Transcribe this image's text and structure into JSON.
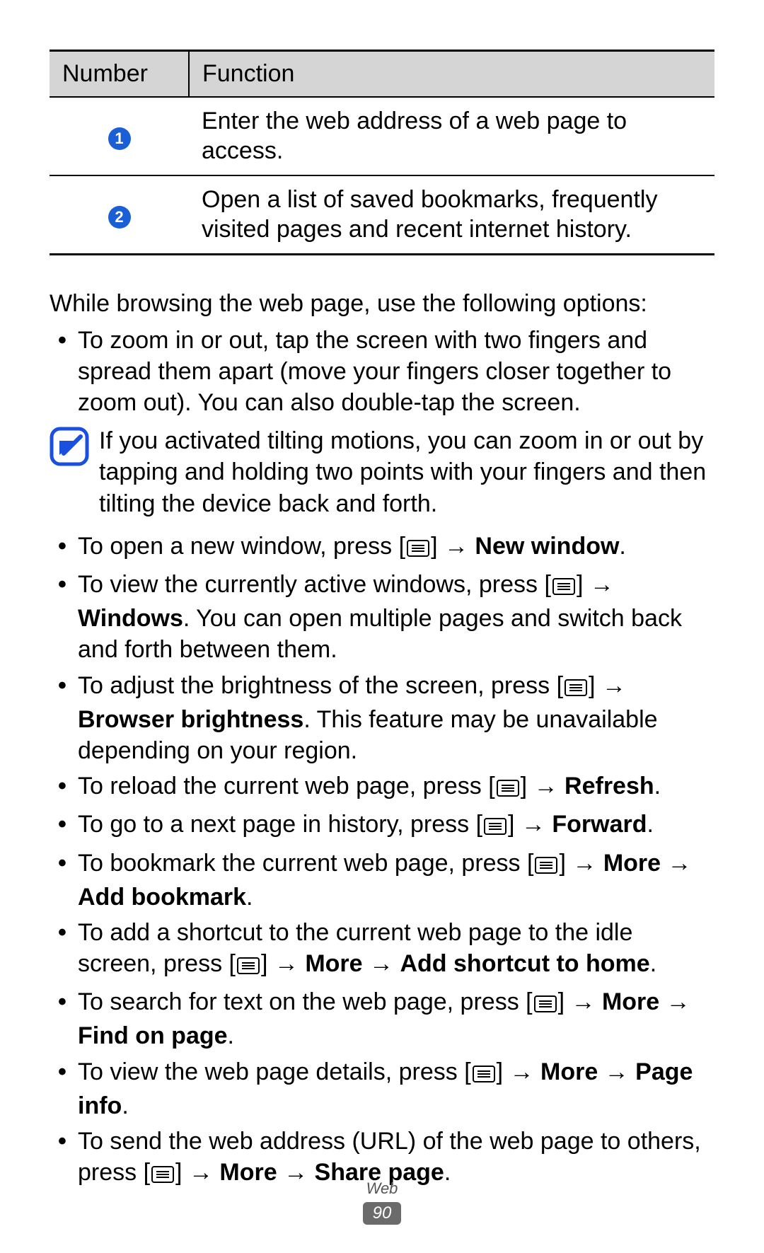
{
  "table": {
    "headers": {
      "number": "Number",
      "function": "Function"
    },
    "rows": [
      {
        "num": "1",
        "func": "Enter the web address of a web page to access."
      },
      {
        "num": "2",
        "func": "Open a list of saved bookmarks, frequently visited pages and recent internet history."
      }
    ]
  },
  "intro": "While browsing the web page, use the following options:",
  "bullets": {
    "zoom": "To zoom in or out, tap the screen with two fingers and spread them apart (move your fingers closer together to zoom out). You can also double-tap the screen.",
    "note": "If you activated tilting motions, you can zoom in or out by tapping and holding two points with your fingers and then tilting the device back and forth.",
    "new_window_pre": "To open a new window, press [",
    "arrow": " → ",
    "new_window_bold": "New window",
    "period": ".",
    "active_windows_pre": "To view the currently active windows, press [",
    "windows_bold": "Windows",
    "windows_post": ". You can open multiple pages and switch back and forth between them.",
    "bright_pre": "To adjust the brightness of the screen, press [",
    "bright_bold": "Browser brightness",
    "bright_post": ". This feature may be unavailable depending on your region.",
    "reload_pre": "To reload the current web page, press [",
    "refresh_bold": "Refresh",
    "forward_pre": "To go to a next page in history, press [",
    "forward_bold": "Forward",
    "bookmark_pre": "To bookmark the current web page, press [",
    "more_bold": "More",
    "add_bookmark_bold": "Add bookmark",
    "shortcut_pre": "To add a shortcut to the current web page to the idle screen, press [",
    "add_shortcut_bold": "Add shortcut to home",
    "search_pre": "To search for text on the web page, press [",
    "find_bold": "Find on page",
    "details_pre": "To view the web page details, press [",
    "page_info_bold": "Page info",
    "send_pre": "To send the web address (URL) of the web page to others, press [",
    "share_bold": "Share page",
    "close_bracket": "]"
  },
  "footer": {
    "section": "Web",
    "page": "90"
  }
}
